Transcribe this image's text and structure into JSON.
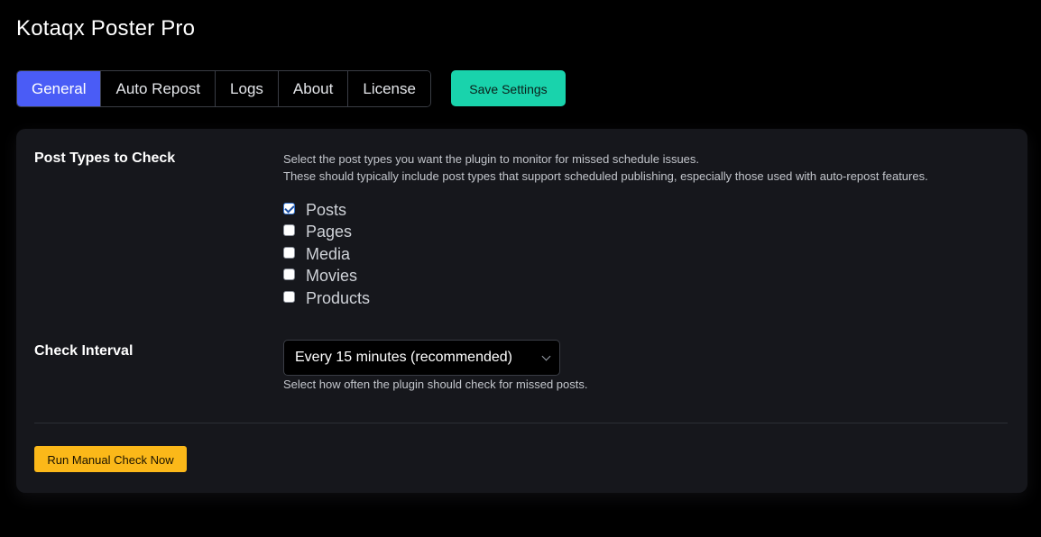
{
  "app": {
    "title": "Kotaqx Poster Pro"
  },
  "tabs": [
    {
      "label": "General",
      "active": true
    },
    {
      "label": "Auto Repost",
      "active": false
    },
    {
      "label": "Logs",
      "active": false
    },
    {
      "label": "About",
      "active": false
    },
    {
      "label": "License",
      "active": false
    }
  ],
  "toolbar": {
    "save_label": "Save Settings"
  },
  "post_types": {
    "label": "Post Types to Check",
    "description_line1": "Select the post types you want the plugin to monitor for missed schedule issues.",
    "description_line2": "These should typically include post types that support scheduled publishing, especially those used with auto-repost features.",
    "options": [
      {
        "label": "Posts",
        "checked": true
      },
      {
        "label": "Pages",
        "checked": false
      },
      {
        "label": "Media",
        "checked": false
      },
      {
        "label": "Movies",
        "checked": false
      },
      {
        "label": "Products",
        "checked": false
      }
    ]
  },
  "check_interval": {
    "label": "Check Interval",
    "selected": "Every 15 minutes (recommended)",
    "description": "Select how often the plugin should check for missed posts."
  },
  "actions": {
    "run_label": "Run Manual Check Now"
  },
  "colors": {
    "background": "#000000",
    "panel": "#16171c",
    "tab_active": "#4a5cf6",
    "save_button": "#19d3ac",
    "run_button": "#fbb819"
  }
}
